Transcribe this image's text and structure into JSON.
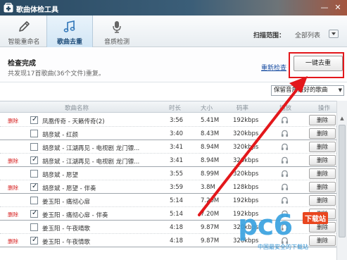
{
  "window": {
    "title": "歌曲体检工具",
    "minimize_label": "—",
    "close_label": "✕"
  },
  "tabs": [
    {
      "label": "智能重命名",
      "icon": "pencil-icon",
      "active": false
    },
    {
      "label": "歌曲去重",
      "icon": "music-note-icon",
      "active": true
    },
    {
      "label": "音质检测",
      "icon": "microphone-icon",
      "active": false
    }
  ],
  "scan": {
    "label": "扫描范围：",
    "value": "全部列表"
  },
  "status": {
    "title": "检查完成",
    "subtitle": "共发现17首歌曲(36个文件)重复。",
    "recheck_label": "重新检查",
    "dedupe_button_label": "一键去重"
  },
  "keep_select": {
    "value": "保留音质最好的歌曲"
  },
  "table": {
    "headers": {
      "name": "歌曲名称",
      "duration": "时长",
      "size": "大小",
      "bitrate": "码率",
      "play": "播放",
      "action": "操作"
    },
    "row_delete_label": "删除",
    "delete_tag_label": "删除",
    "rows": [
      {
        "tag": true,
        "checked": true,
        "name": "凤凰传奇 - 天籁传奇(2)",
        "duration": "3:56",
        "size": "5.41M",
        "bitrate": "192kbps",
        "group_end": false
      },
      {
        "tag": false,
        "checked": false,
        "name": "胡彦斌 - 红颜",
        "duration": "3:40",
        "size": "8.43M",
        "bitrate": "320kbps",
        "group_end": true
      },
      {
        "tag": false,
        "checked": false,
        "name": "胡彦斌 - 江湖再见 - 电视剧 龙门镖...",
        "duration": "3:41",
        "size": "8.94M",
        "bitrate": "320kbps",
        "group_end": false
      },
      {
        "tag": true,
        "checked": true,
        "name": "胡彦斌 - 江湖再见 - 电视剧 龙门镖...",
        "duration": "3:41",
        "size": "8.94M",
        "bitrate": "320kbps",
        "group_end": true
      },
      {
        "tag": false,
        "checked": false,
        "name": "胡彦斌 - 愿望",
        "duration": "3:55",
        "size": "8.99M",
        "bitrate": "320kbps",
        "group_end": false
      },
      {
        "tag": true,
        "checked": true,
        "name": "胡彦斌 - 愿望 - 伴奏",
        "duration": "3:59",
        "size": "3.8M",
        "bitrate": "128kbps",
        "group_end": true
      },
      {
        "tag": false,
        "checked": false,
        "name": "姜玉阳 - 痛彻心扉",
        "duration": "5:14",
        "size": "7.20M",
        "bitrate": "192kbps",
        "group_end": false
      },
      {
        "tag": true,
        "checked": true,
        "name": "姜玉阳 - 痛彻心扉 - 伴奏",
        "duration": "5:14",
        "size": "7.20M",
        "bitrate": "192kbps",
        "group_end": true
      },
      {
        "tag": false,
        "checked": false,
        "name": "姜玉阳 - 午夜晴歌",
        "duration": "4:18",
        "size": "9.87M",
        "bitrate": "320kbps",
        "group_end": false
      },
      {
        "tag": true,
        "checked": true,
        "name": "姜玉阳 - 午夜情歌",
        "duration": "4:18",
        "size": "9.87M",
        "bitrate": "320kbps",
        "group_end": true
      }
    ]
  },
  "watermark": {
    "logo": "pc6",
    "tag": "下载站",
    "site": "中国最安全的下载站"
  },
  "colors": {
    "accent_red": "#e3171b",
    "link_blue": "#1a4ea2",
    "title_bar": "#2a4a63"
  }
}
